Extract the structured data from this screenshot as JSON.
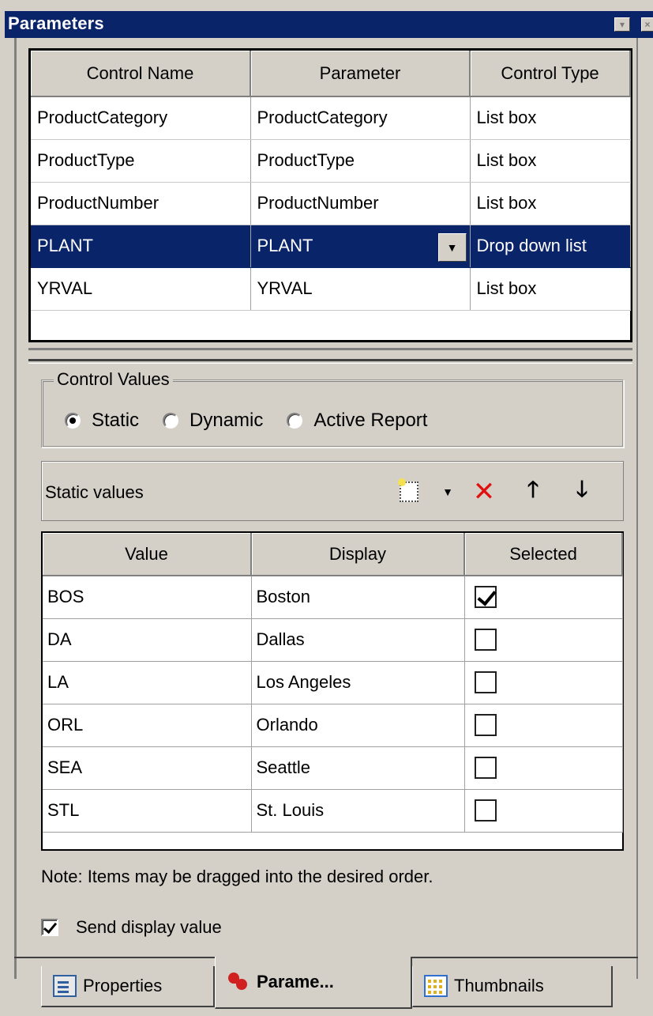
{
  "window": {
    "title": "Parameters",
    "close_glyph": "×",
    "dropdown_glyph": "▾"
  },
  "controls_grid": {
    "columns": [
      "Control Name",
      "Parameter",
      "Control Type"
    ],
    "rows": [
      {
        "name": "ProductCategory",
        "parameter": "ProductCategory",
        "type": "List box"
      },
      {
        "name": "ProductType",
        "parameter": "ProductType",
        "type": "List box"
      },
      {
        "name": "ProductNumber",
        "parameter": "ProductNumber",
        "type": "List box"
      },
      {
        "name": "PLANT",
        "parameter": "PLANT",
        "type": "Drop down list"
      },
      {
        "name": "YRVAL",
        "parameter": "YRVAL",
        "type": "List box"
      }
    ],
    "selected_row": 3
  },
  "control_values": {
    "legend": "Control Values",
    "options": [
      "Static",
      "Dynamic",
      "Active Report"
    ],
    "selected": "Static"
  },
  "static_values_toolbar": {
    "label": "Static values",
    "icons": [
      "new-value-icon",
      "dropdown-caret-icon",
      "delete-icon",
      "move-up-icon",
      "move-down-icon"
    ]
  },
  "values_grid": {
    "columns": [
      "Value",
      "Display",
      "Selected"
    ],
    "rows": [
      {
        "value": "BOS",
        "display": "Boston",
        "selected": true
      },
      {
        "value": "DA",
        "display": "Dallas",
        "selected": false
      },
      {
        "value": "LA",
        "display": "Los Angeles",
        "selected": false
      },
      {
        "value": "ORL",
        "display": "Orlando",
        "selected": false
      },
      {
        "value": "SEA",
        "display": "Seattle",
        "selected": false
      },
      {
        "value": "STL",
        "display": "St. Louis",
        "selected": false
      }
    ]
  },
  "note": "Note:  Items may be dragged into the desired order.",
  "send_display_value": {
    "label": "Send display value",
    "checked": true
  },
  "tabs": [
    {
      "label": "Properties",
      "icon": "properties-icon",
      "active": false
    },
    {
      "label": "Parame...",
      "icon": "parameters-icon",
      "active": true
    },
    {
      "label": "Thumbnails",
      "icon": "thumbnails-icon",
      "active": false
    }
  ],
  "colors": {
    "titlebar": "#0a246a",
    "selection": "#0a246a",
    "face": "#d4d0c8",
    "delete_icon": "#e01010"
  }
}
